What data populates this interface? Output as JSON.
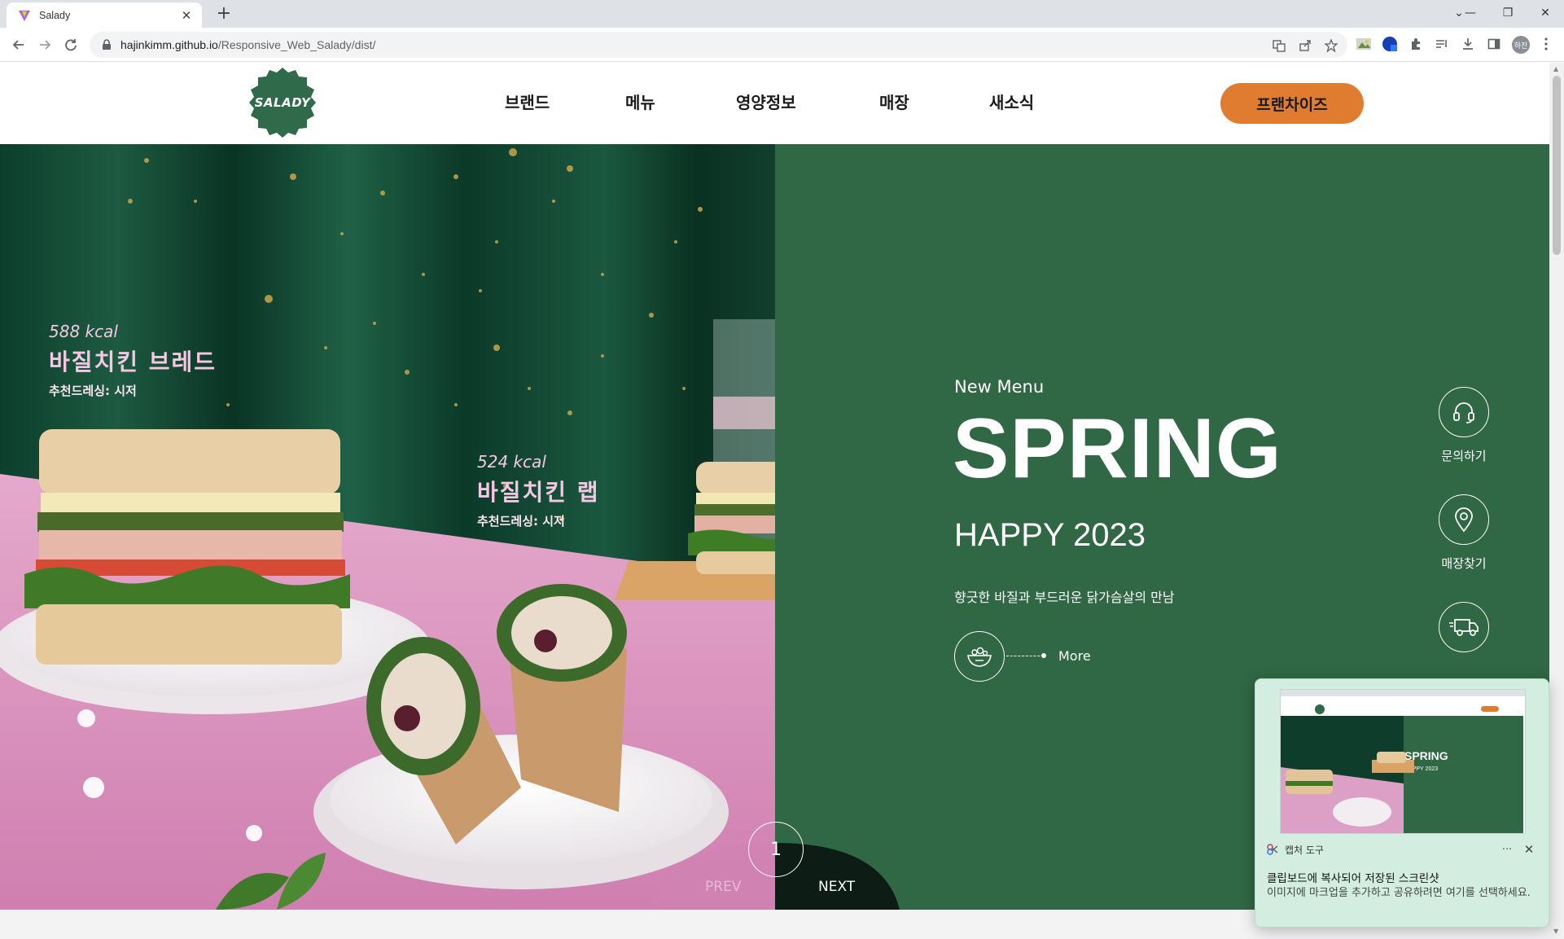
{
  "browser": {
    "tab_title": "Salady",
    "url_host": "hajinkimm.github.io",
    "url_path": "/Responsive_Web_Salady/dist/",
    "avatar_text": "하진"
  },
  "site": {
    "logo_text": "SALADY",
    "nav": [
      "브랜드",
      "메뉴",
      "영양정보",
      "매장",
      "새소식"
    ],
    "franchise_label": "프랜차이즈"
  },
  "hero": {
    "photo": {
      "item1_kcal": "588 kcal",
      "item1_name": "바질치킨 브레드",
      "item1_dressing": "추천드레싱: 시저",
      "item2_kcal": "524 kcal",
      "item2_name": "바질치킨 랩",
      "item2_dressing": "추천드레싱: 시저"
    },
    "eyebrow": "New Menu",
    "headline": "SPRING",
    "subheadline": "HAPPY 2023",
    "tagline": "향긋한 바질과 부드러운 닭가슴살의 만남",
    "more_label": "More",
    "side_buttons": [
      {
        "label": "문의하기",
        "icon": "headset-icon"
      },
      {
        "label": "매장찾기",
        "icon": "map-pin-icon"
      },
      {
        "label": "",
        "icon": "delivery-truck-icon"
      }
    ],
    "pager_number": "1",
    "prev_label": "PREV",
    "next_label": "NEXT"
  },
  "toast": {
    "app_name": "캡처 도구",
    "title": "클립보드에 복사되어 저장된 스크린샷",
    "body": "이미지에 마크업을 추가하고 공유하려면 여기를 선택하세요.",
    "more": "···",
    "close": "✕",
    "thumb_headline": "SPRING",
    "thumb_sub": "HAPPY 2023"
  },
  "colors": {
    "brand_green": "#306745",
    "franchise_orange": "#e07c2f",
    "photo_text_pink": "#f5c7e3"
  }
}
